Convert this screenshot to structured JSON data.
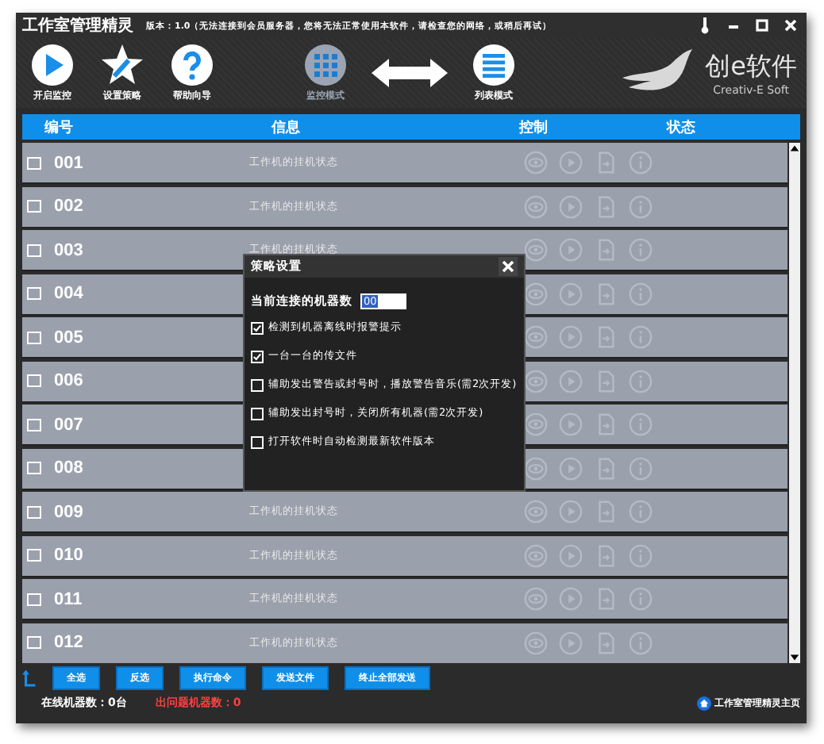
{
  "window": {
    "title": "工作室管理精灵",
    "version_note": "版本：1.0（无法连接到会员服务器，您将无法正常使用本软件，请检查您的网络，或稍后再试）"
  },
  "toolbar": [
    {
      "label": "开启监控",
      "kind": "play"
    },
    {
      "label": "设置策略",
      "kind": "star"
    },
    {
      "label": "帮助向导",
      "kind": "help"
    }
  ],
  "modes": [
    {
      "label": "监控模式",
      "kind": "grid",
      "selected": false
    },
    {
      "label": "列表模式",
      "kind": "list",
      "selected": true
    }
  ],
  "logo": {
    "name": "创e软件",
    "tagline": "Creativ-E Soft"
  },
  "table": {
    "columns": [
      "编号",
      "信息",
      "控制",
      "状态"
    ],
    "rows": [
      {
        "id": "001",
        "info": "工作机的挂机状态",
        "checked": false
      },
      {
        "id": "002",
        "info": "工作机的挂机状态",
        "checked": false
      },
      {
        "id": "003",
        "info": "工作机的挂机状态",
        "checked": false
      },
      {
        "id": "004",
        "checked": false
      },
      {
        "id": "005",
        "checked": false
      },
      {
        "id": "006",
        "checked": false
      },
      {
        "id": "007",
        "checked": false
      },
      {
        "id": "008",
        "checked": false
      },
      {
        "id": "009",
        "info": "工作机的挂机状态",
        "checked": false
      },
      {
        "id": "010",
        "info": "工作机的挂机状态",
        "checked": false
      },
      {
        "id": "011",
        "info": "工作机的挂机状态",
        "checked": false
      },
      {
        "id": "012",
        "info": "工作机的挂机状态",
        "checked": false
      }
    ]
  },
  "buttons": [
    "全选",
    "反选",
    "执行命令",
    "发送文件",
    "终止全部发送"
  ],
  "status_bar": {
    "online": "在线机器数：0台",
    "problem": "出问题机器数：0",
    "home_link": "工作室管理精灵主页"
  },
  "dialog": {
    "title": "策略设置",
    "field_label": "当前连接的机器数",
    "field_value": "00",
    "options": [
      {
        "label": "检测到机器离线时报警提示",
        "checked": true
      },
      {
        "label": "一台一台的传文件",
        "checked": true
      },
      {
        "label": "辅助发出警告或封号时，播放警告音乐(需2次开发)",
        "checked": false
      },
      {
        "label": "辅助发出封号时，关闭所有机器(需2次开发)",
        "checked": false
      },
      {
        "label": "打开软件时自动检测最新软件版本",
        "checked": false
      }
    ]
  }
}
